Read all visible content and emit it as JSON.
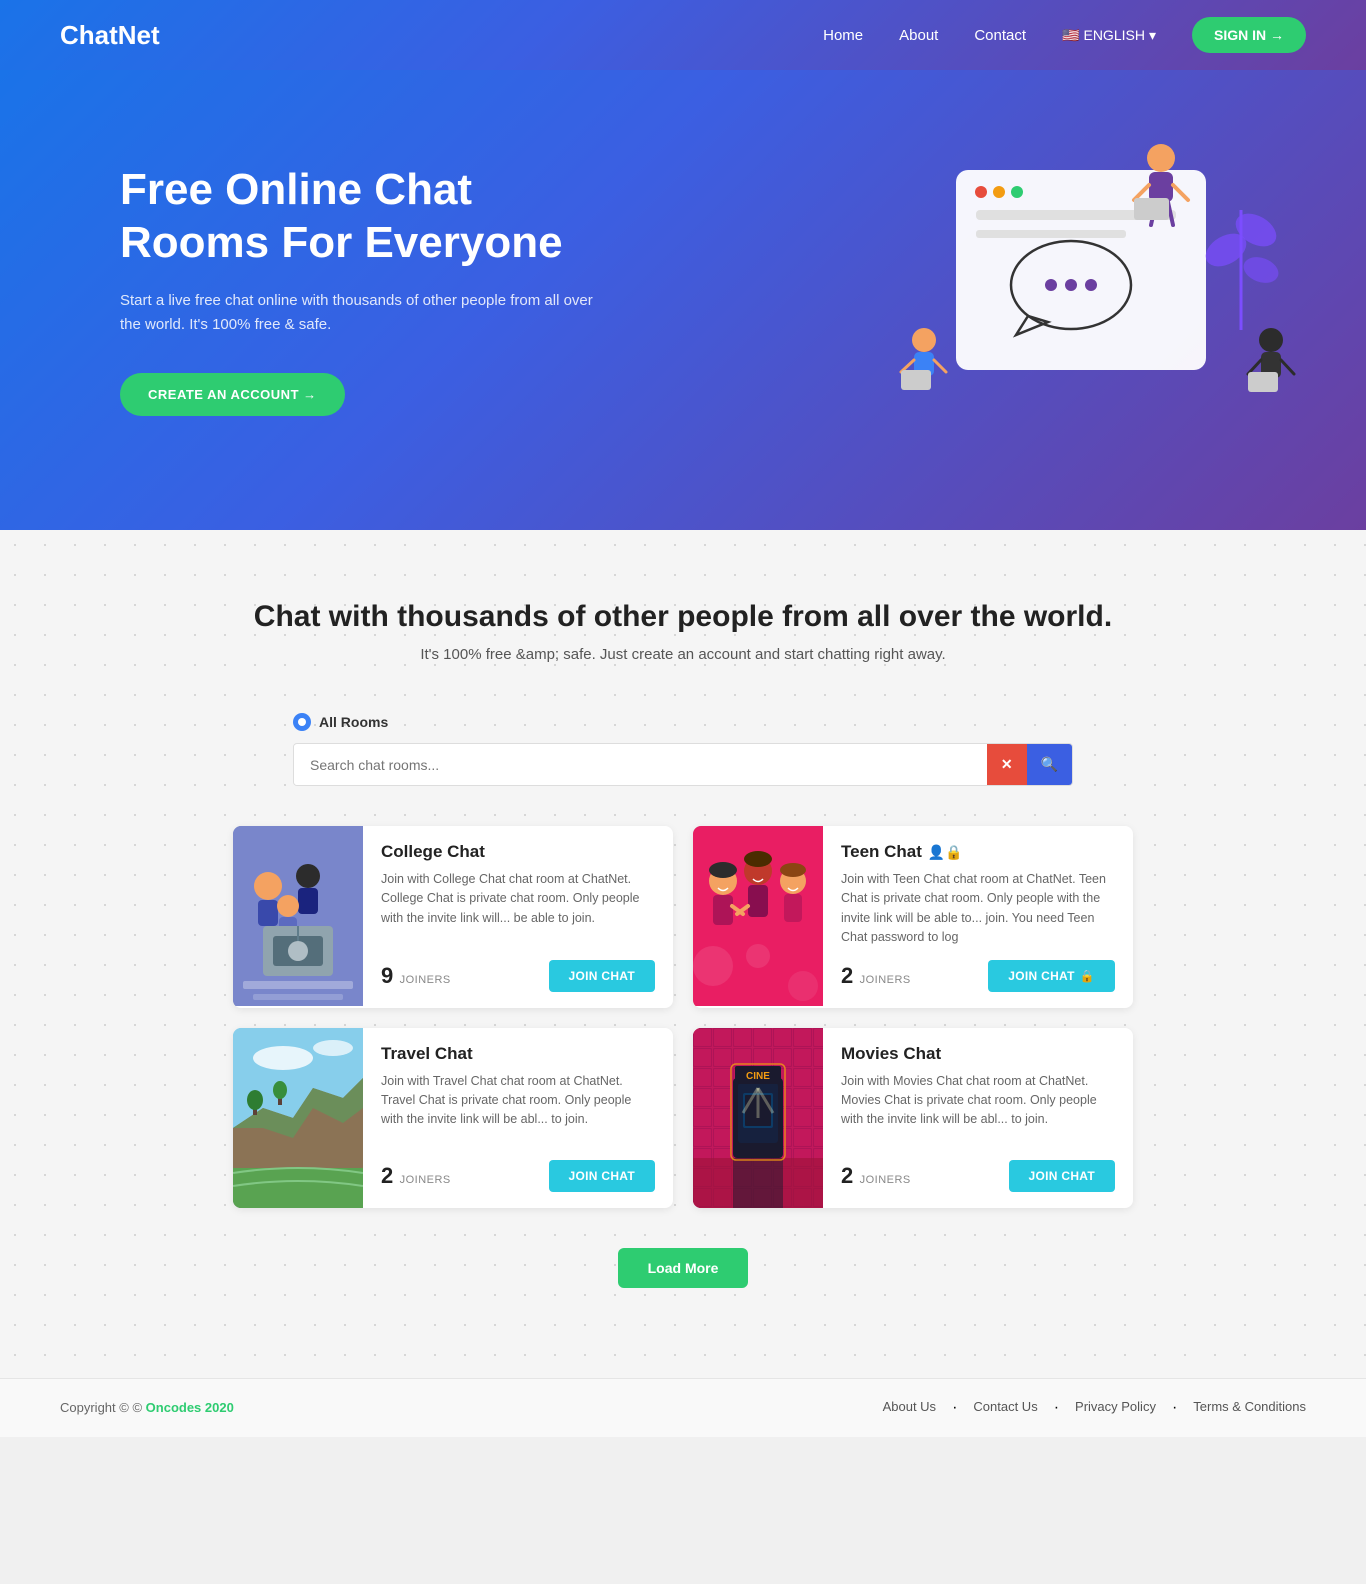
{
  "brand": {
    "name_bold": "Chat",
    "name_regular": "Net"
  },
  "nav": {
    "items": [
      {
        "label": "Home",
        "active": true
      },
      {
        "label": "About",
        "active": false
      },
      {
        "label": "Contact",
        "active": false
      }
    ],
    "lang_label": "ENGLISH",
    "sign_in_label": "SIGN IN →"
  },
  "hero": {
    "heading": "Free Online Chat Rooms For Everyone",
    "subtext": "Start a live free chat online with thousands of other people from all over the world. It's 100% free & safe.",
    "cta_label": "CREATE AN ACCOUNT →"
  },
  "section": {
    "heading": "Chat with thousands of other people from all over the world.",
    "subtext": "It's 100% free &amp; safe. Just create an account and start chatting right away.",
    "all_rooms_label": "All Rooms",
    "search_placeholder": "Search chat rooms...",
    "clear_btn": "✕",
    "search_btn": "🔍"
  },
  "rooms": [
    {
      "id": "college",
      "title": "College Chat",
      "description": "Join with College Chat chat room at ChatNet. College Chat is private chat room. Only people with the invite link will... be able to join.",
      "joiners": 9,
      "join_label": "JOIN CHAT",
      "locked": false,
      "img_style": "college"
    },
    {
      "id": "teen",
      "title": "Teen Chat",
      "description": "Join with Teen Chat chat room at ChatNet. Teen Chat is private chat room. Only people with the invite link will be able to... join. You need Teen Chat password to log",
      "joiners": 2,
      "join_label": "JOIN CHAT 🔒",
      "locked": true,
      "img_style": "teen"
    },
    {
      "id": "travel",
      "title": "Travel Chat",
      "description": "Join with Travel Chat chat room at ChatNet. Travel Chat is private chat room. Only people with the invite link will be abl... to join.",
      "joiners": 2,
      "join_label": "JOIN CHAT",
      "locked": false,
      "img_style": "travel"
    },
    {
      "id": "movies",
      "title": "Movies Chat",
      "description": "Join with Movies Chat chat room at ChatNet. Movies Chat is private chat room. Only people with the invite link will be abl... to join.",
      "joiners": 2,
      "join_label": "JOIN CHAT",
      "locked": false,
      "img_style": "movies"
    }
  ],
  "load_more_label": "Load More",
  "footer": {
    "copy_text": "Copyright © ",
    "copy_link": "Oncodes 2020",
    "links": [
      {
        "label": "About Us"
      },
      {
        "label": "Contact Us"
      },
      {
        "label": "Privacy Policy"
      },
      {
        "label": "Terms & Conditions"
      }
    ]
  }
}
